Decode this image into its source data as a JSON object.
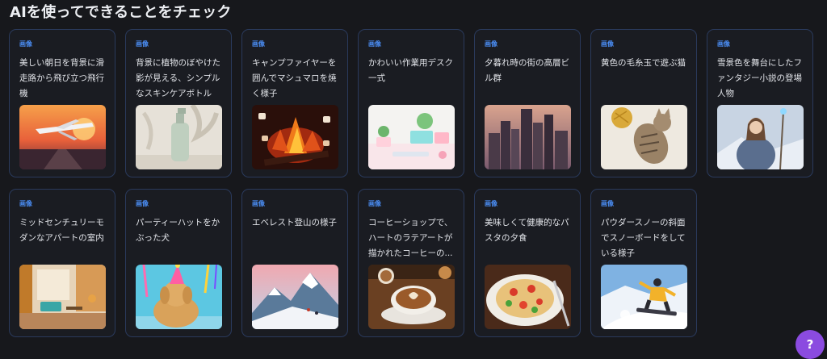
{
  "page_title": "AIを使ってできることをチェック",
  "cards": [
    {
      "tag": "画像",
      "title": "美しい朝日を背景に滑走路から飛び立つ飛行機",
      "image": "airplane-sunrise-image"
    },
    {
      "tag": "画像",
      "title": "背景に植物のぼやけた影が見える、シンプルなスキンケアボトル",
      "image": "skincare-bottle-image"
    },
    {
      "tag": "画像",
      "title": "キャンプファイヤーを囲んでマシュマロを焼く様子",
      "image": "campfire-marshmallow-image"
    },
    {
      "tag": "画像",
      "title": "かわいい作業用デスク一式",
      "image": "cute-desk-image"
    },
    {
      "tag": "画像",
      "title": "夕暮れ時の街の高層ビル群",
      "image": "city-skyscrapers-image"
    },
    {
      "tag": "画像",
      "title": "黄色の毛糸玉で遊ぶ猫",
      "image": "cat-yarn-image"
    },
    {
      "tag": "画像",
      "title": "雪景色を舞台にしたファンタジー小説の登場人物",
      "image": "fantasy-character-image"
    },
    {
      "tag": "画像",
      "title": "ミッドセンチュリーモダンなアパートの室内",
      "image": "midcentury-room-image"
    },
    {
      "tag": "画像",
      "title": "パーティーハットをかぶった犬",
      "image": "party-dog-image"
    },
    {
      "tag": "画像",
      "title": "エベレスト登山の様子",
      "image": "everest-climb-image"
    },
    {
      "tag": "画像",
      "title": "コーヒーショップで、ハートのラテアートが描かれたコーヒーの...",
      "image": "latte-art-image"
    },
    {
      "tag": "画像",
      "title": "美味しくて健康的なパスタの夕食",
      "image": "pasta-dinner-image"
    },
    {
      "tag": "画像",
      "title": "パウダースノーの斜面でスノーボードをしている様子",
      "image": "snowboard-image"
    }
  ],
  "help_button": {
    "label": "?"
  },
  "colors": {
    "background": "#17181c",
    "card_border": "#2a3a5c",
    "tag": "#4a8cf2",
    "help_button": "#8b4be0"
  }
}
